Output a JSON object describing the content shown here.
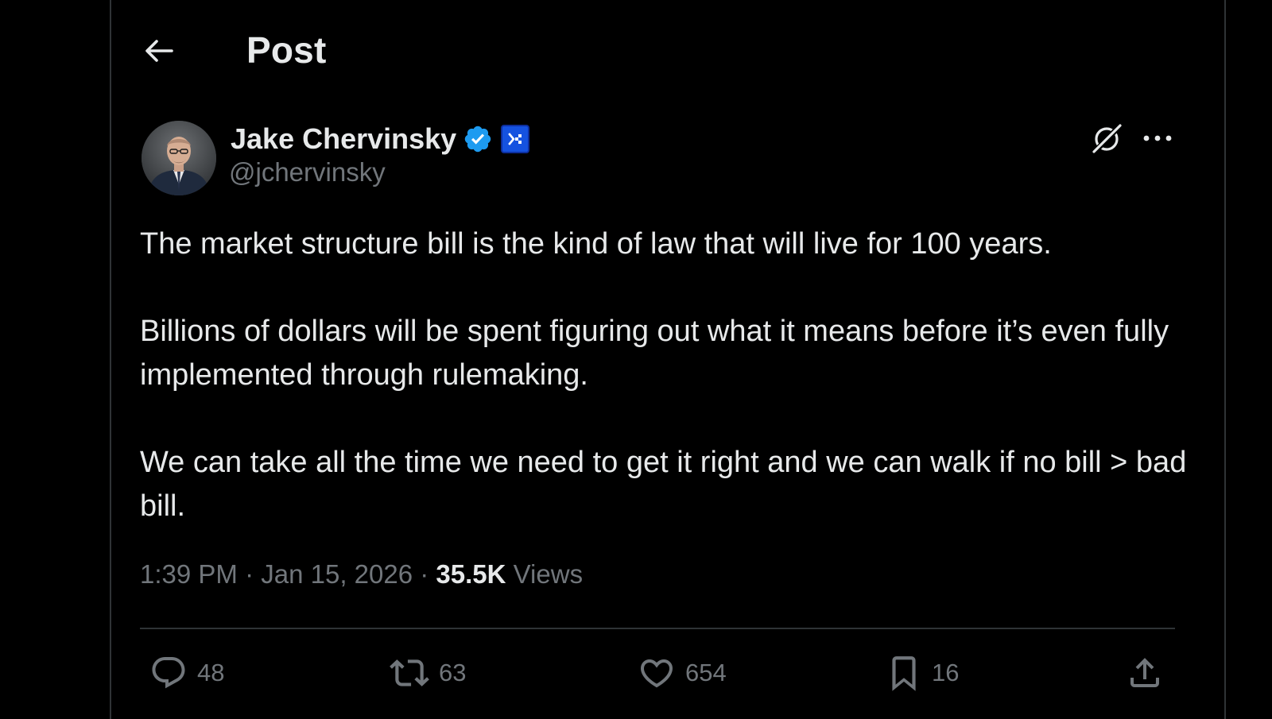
{
  "header": {
    "title": "Post"
  },
  "author": {
    "display_name": "Jake Chervinsky",
    "handle": "@jchervinsky",
    "verified": true,
    "badge_color": "#1d9bf0",
    "affiliate_badge_color": "#1552e0"
  },
  "post": {
    "paragraphs": [
      "The market structure bill is the kind of law that will live for 100 years.",
      "Billions of dollars will be spent figuring out what it means before it’s even fully implemented through rulemaking.",
      "We can take all the time we need to get it right and we can walk if no bill > bad bill."
    ],
    "time": "1:39 PM",
    "separator": " · ",
    "date": "Jan 15, 2026",
    "views_count": "35.5K",
    "views_label": " Views"
  },
  "actions": {
    "replies": "48",
    "reposts": "63",
    "likes": "654",
    "bookmarks": "16"
  },
  "icons": {
    "back": "arrow-left-icon",
    "verified": "verified-check-icon",
    "affiliate": "affiliate-badge-icon",
    "grok": "grok-icon",
    "more": "more-horizontal-icon",
    "reply": "reply-icon",
    "repost": "repost-icon",
    "like": "heart-icon",
    "bookmark": "bookmark-icon",
    "share": "share-icon"
  },
  "theme": {
    "background": "#000000",
    "text_primary": "#e7e9ea",
    "text_secondary": "#71767b",
    "border": "#2f3336"
  }
}
